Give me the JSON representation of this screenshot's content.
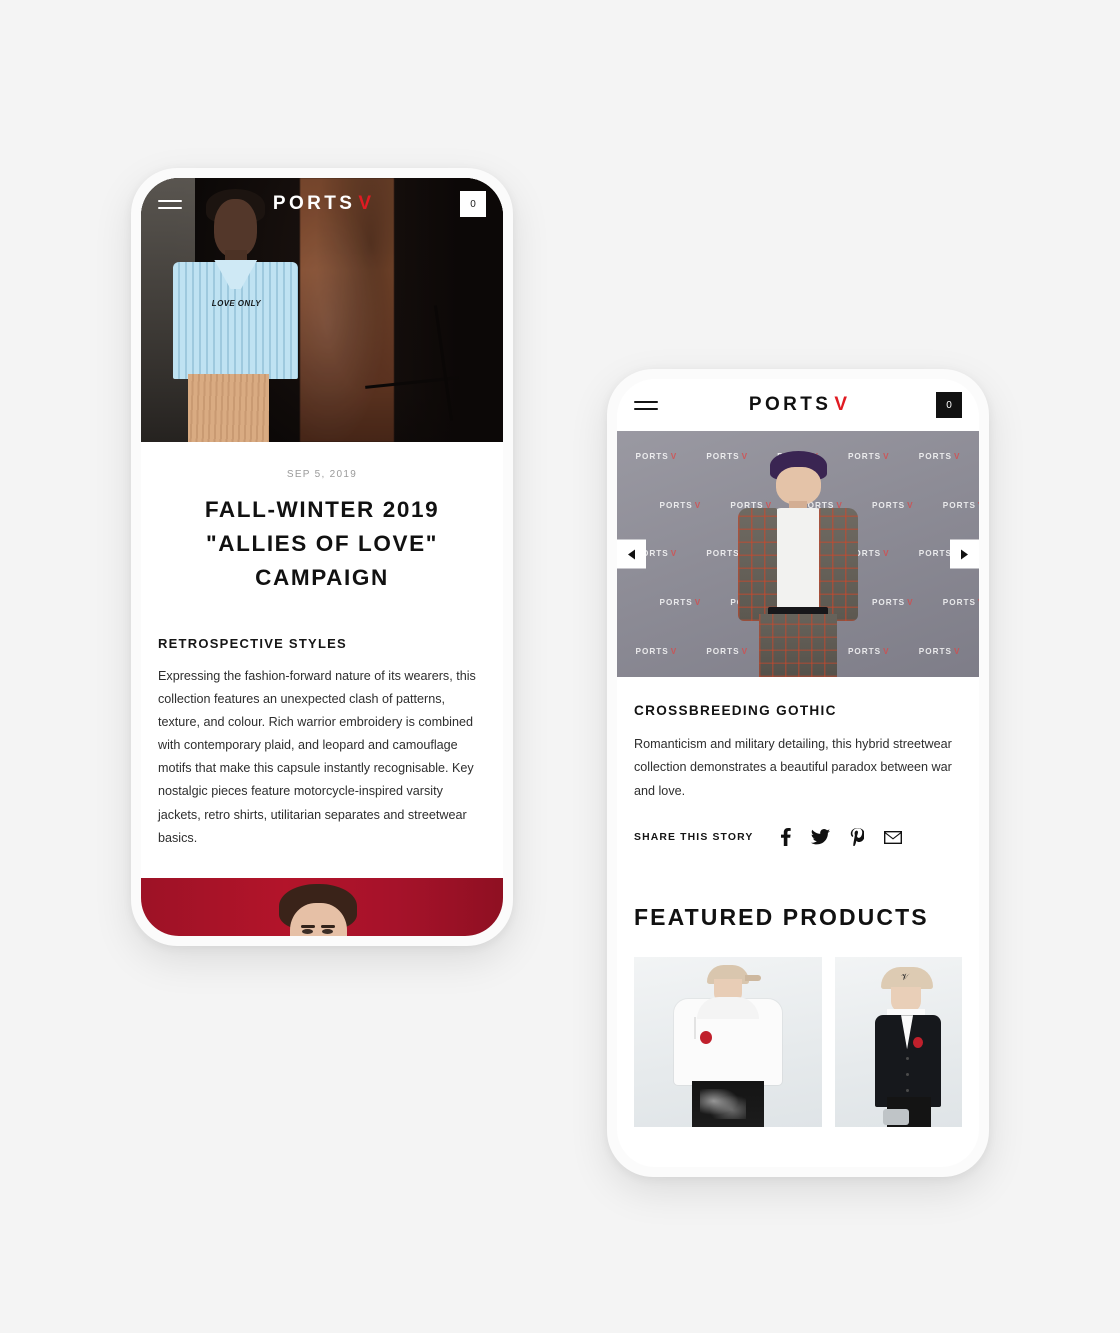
{
  "page": {
    "background_color": "#f4f4f4",
    "brand_accent_color": "#e01b22"
  },
  "phone_one": {
    "header": {
      "menu_icon": "hamburger-icon",
      "brand_name": "PORTS",
      "brand_mark": "V",
      "cart_count": "0"
    },
    "hero": {
      "alt": "Model in light blue striped LOVE ONLY shirt in industrial setting",
      "shirt_text": "LOVE ONLY"
    },
    "article": {
      "date": "SEP 5, 2019",
      "title": "FALL-WINTER 2019 \"ALLIES OF LOVE\" CAMPAIGN",
      "subtitle": "RETROSPECTIVE STYLES",
      "body": " Expressing the fashion-forward nature of its wearers, this collection features an unexpected clash of patterns, texture, and colour. Rich warrior embroidery is combined with contemporary plaid, and leopard and camouflage motifs that make this capsule instantly recognisable. Key nostalgic pieces feature motorcycle-inspired varsity jackets, retro shirts, utilitarian separates and streetwear basics."
    },
    "footer_image": {
      "alt": "Model portrait on crimson red background",
      "background_color": "#a6122a"
    }
  },
  "phone_two": {
    "header": {
      "menu_icon": "hamburger-icon",
      "brand_name": "PORTS",
      "brand_mark": "V",
      "cart_count": "0"
    },
    "carousel": {
      "alt": "Model in grey and red plaid suit at PORTS V step-and-repeat backdrop",
      "backdrop_logo": "PORTS",
      "backdrop_logo_mark": "V",
      "prev_label": "prev-arrow-icon",
      "next_label": "next-arrow-icon"
    },
    "story": {
      "heading": "CROSSBREEDING GOTHIC",
      "body": "Romanticism and military detailing, this hybrid streetwear collection demonstrates a beautiful paradox between war and love.",
      "share_label": "SHARE THIS STORY",
      "share_icons": [
        "facebook-icon",
        "twitter-icon",
        "pinterest-icon",
        "email-icon"
      ]
    },
    "featured": {
      "title": "FEATURED PRODUCTS",
      "products": [
        {
          "alt": "Model in white hoodie with red patch and black printed trousers"
        },
        {
          "alt": "Model in beige cap and dark cardigan with red patch"
        }
      ]
    }
  }
}
